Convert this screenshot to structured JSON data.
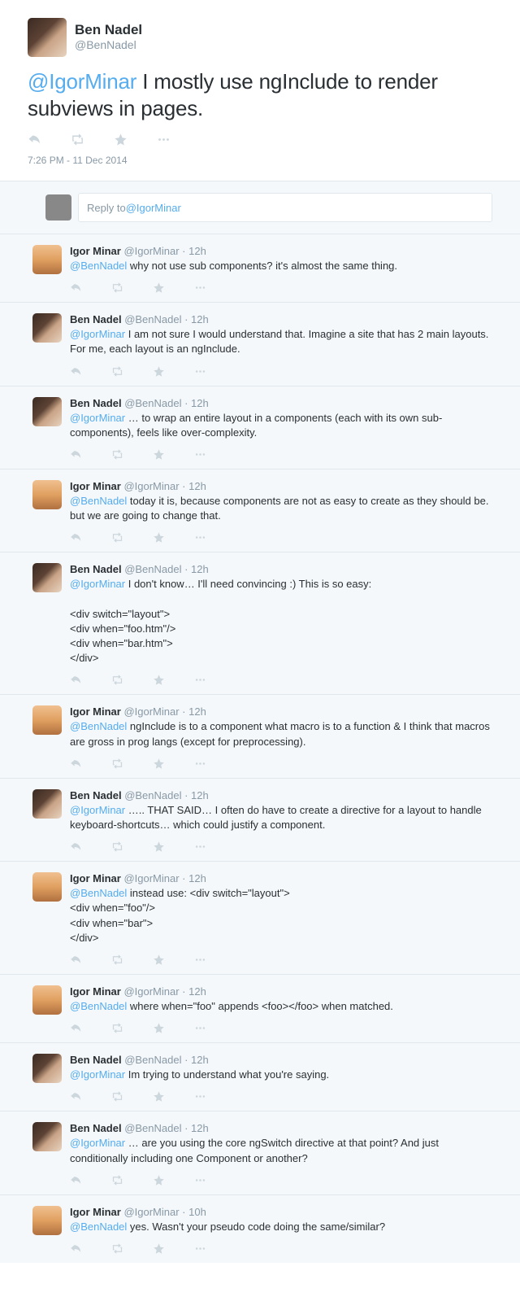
{
  "main": {
    "author": "Ben Nadel",
    "handle": "@BenNadel",
    "mention": "@IgorMinar",
    "text_rest": " I mostly use ngInclude to render subviews in pages.",
    "timestamp": "7:26 PM - 11 Dec 2014"
  },
  "reply_box": {
    "prefix": "Reply to ",
    "mention": "@IgorMinar"
  },
  "replies": [
    {
      "avatar": "igor",
      "author": "Igor Minar",
      "handle": "@IgorMinar",
      "time": "12h",
      "mention": "@BenNadel",
      "text": " why not use sub components? it's almost the same thing."
    },
    {
      "avatar": "ben",
      "author": "Ben Nadel",
      "handle": "@BenNadel",
      "time": "12h",
      "mention": "@IgorMinar",
      "text": " I am not sure I would understand that. Imagine a site that has 2 main layouts. For me, each layout is an ngInclude."
    },
    {
      "avatar": "ben",
      "author": "Ben Nadel",
      "handle": "@BenNadel",
      "time": "12h",
      "mention": "@IgorMinar",
      "text": " … to wrap an entire layout in a components (each with its own sub-components), feels like over-complexity."
    },
    {
      "avatar": "igor",
      "author": "Igor Minar",
      "handle": "@IgorMinar",
      "time": "12h",
      "mention": "@BenNadel",
      "text": " today it is, because components are not as easy to create as they should be. but we are going to change that."
    },
    {
      "avatar": "ben",
      "author": "Ben Nadel",
      "handle": "@BenNadel",
      "time": "12h",
      "mention": "@IgorMinar",
      "text": " I don't know… I'll need convincing :) This is so easy:\n\n<div switch=\"layout\">\n<div when=\"foo.htm\"/>\n<div when=\"bar.htm\">\n</div>"
    },
    {
      "avatar": "igor",
      "author": "Igor Minar",
      "handle": "@IgorMinar",
      "time": "12h",
      "mention": "@BenNadel",
      "text": " ngInclude is to a component what macro is to a function & I think that macros are gross in prog langs (except for preprocessing)."
    },
    {
      "avatar": "ben",
      "author": "Ben Nadel",
      "handle": "@BenNadel",
      "time": "12h",
      "mention": "@IgorMinar",
      "text": " ….. THAT SAID… I often do have to create a directive for a layout to handle keyboard-shortcuts… which could justify a component."
    },
    {
      "avatar": "igor",
      "author": "Igor Minar",
      "handle": "@IgorMinar",
      "time": "12h",
      "mention": "@BenNadel",
      "text": " instead use: <div switch=\"layout\">\n<div when=\"foo\"/>\n<div when=\"bar\">\n</div>"
    },
    {
      "avatar": "igor",
      "author": "Igor Minar",
      "handle": "@IgorMinar",
      "time": "12h",
      "mention": "@BenNadel",
      "text": " where when=\"foo\" appends <foo></foo> when matched."
    },
    {
      "avatar": "ben",
      "author": "Ben Nadel",
      "handle": "@BenNadel",
      "time": "12h",
      "mention": "@IgorMinar",
      "text": " Im trying to understand what you're saying."
    },
    {
      "avatar": "ben",
      "author": "Ben Nadel",
      "handle": "@BenNadel",
      "time": "12h",
      "mention": "@IgorMinar",
      "text": " … are you using the core ngSwitch directive at that point? And just conditionally including one Component or another?"
    },
    {
      "avatar": "igor",
      "author": "Igor Minar",
      "handle": "@IgorMinar",
      "time": "10h",
      "mention": "@BenNadel",
      "text": " yes. Wasn't your pseudo code doing the same/similar?"
    }
  ]
}
